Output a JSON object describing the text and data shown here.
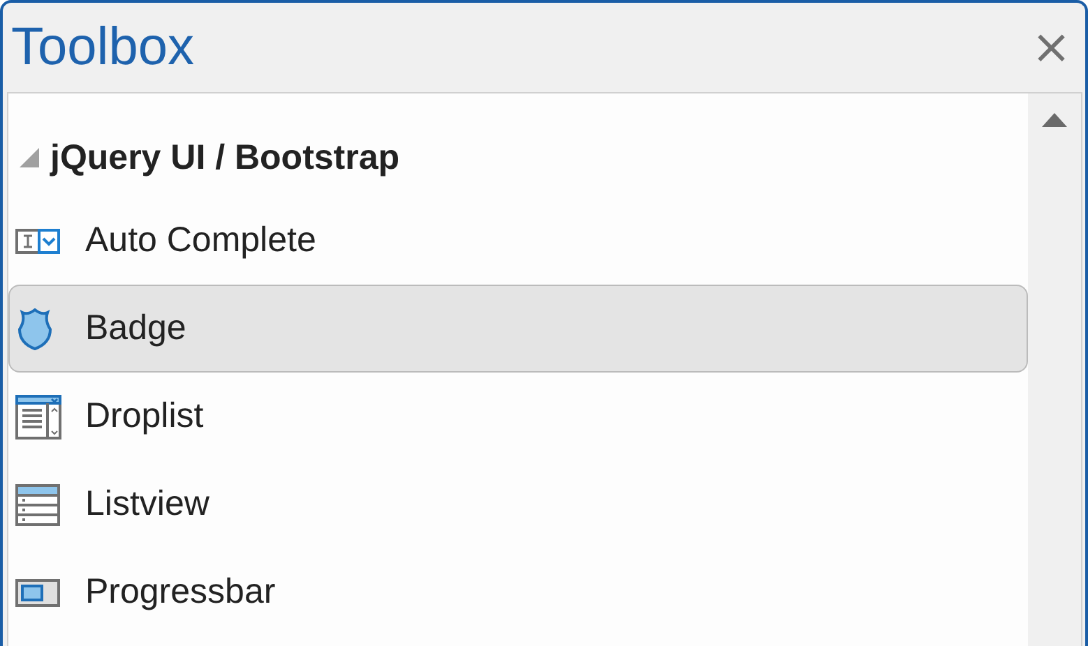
{
  "window": {
    "title": "Toolbox",
    "close": "×"
  },
  "group": {
    "label": "jQuery UI / Bootstrap",
    "expanded": true,
    "items": [
      {
        "label": "Auto Complete",
        "kind": "autocomplete",
        "selected": false
      },
      {
        "label": "Badge",
        "kind": "badge",
        "selected": true
      },
      {
        "label": "Droplist",
        "kind": "droplist",
        "selected": false
      },
      {
        "label": "Listview",
        "kind": "listview",
        "selected": false
      },
      {
        "label": "Progressbar",
        "kind": "progressbar",
        "selected": false
      }
    ]
  }
}
